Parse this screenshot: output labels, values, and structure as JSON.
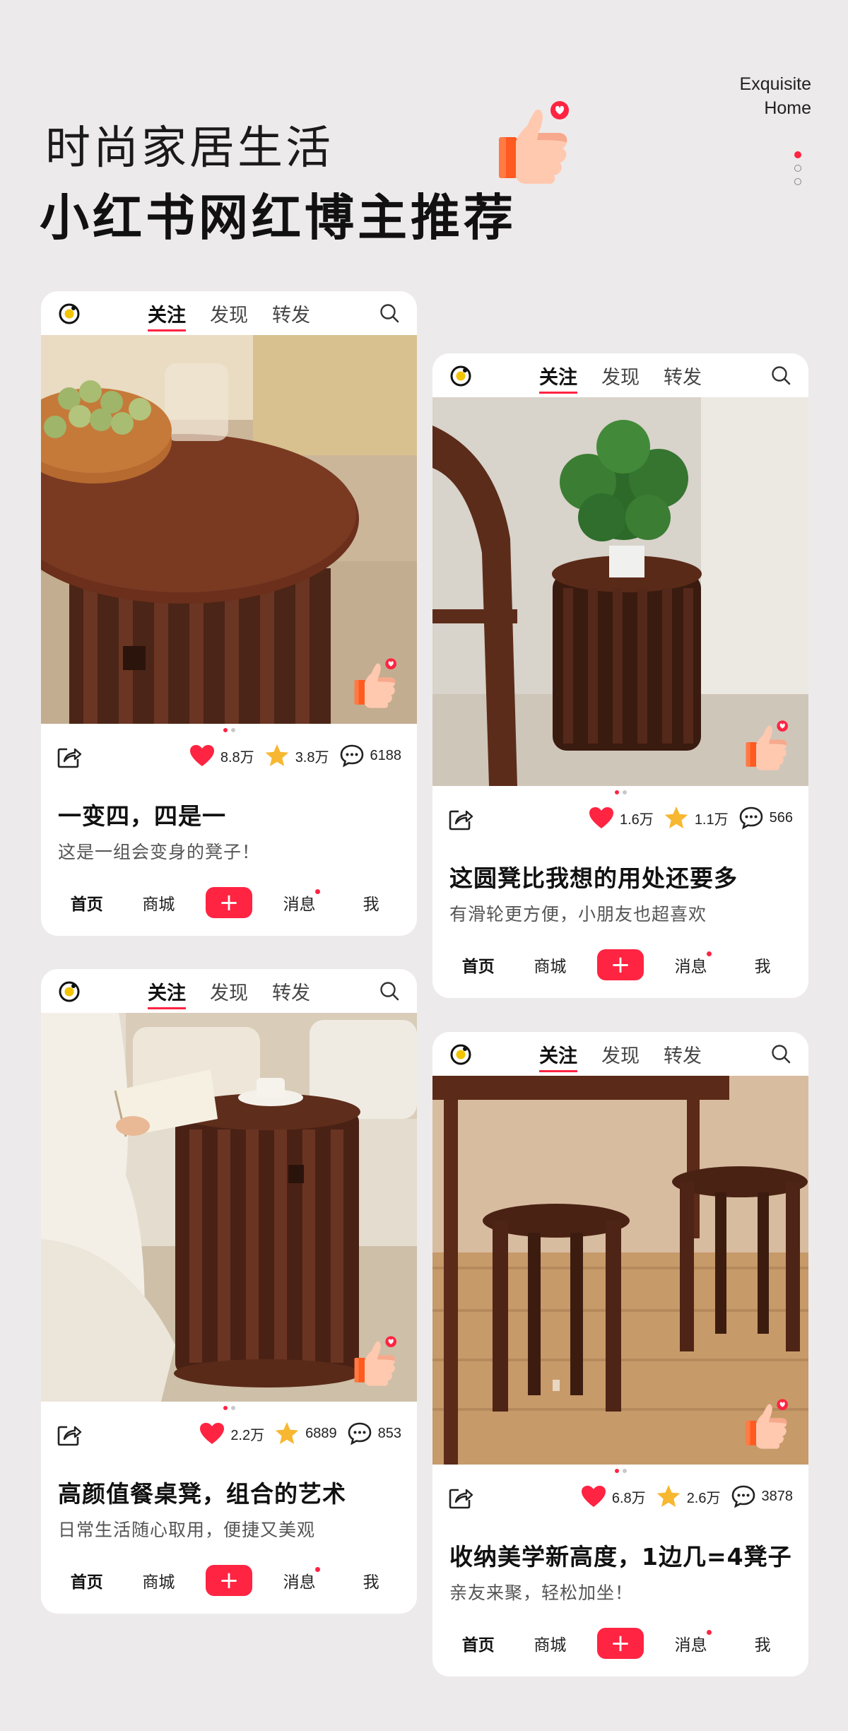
{
  "header": {
    "title_line1": "时尚家居生活",
    "title_line2": "小红书网红博主推荐",
    "brand_line1": "Exquisite",
    "brand_line2": "Home"
  },
  "colors": {
    "accent": "#ff2442",
    "background": "#edeaeb",
    "star": "#f7b731",
    "wood": "#5a2d1c"
  },
  "nav": {
    "tabs": [
      "关注",
      "发现",
      "转发"
    ],
    "bottom": [
      "首页",
      "商城",
      "+",
      "消息",
      "我"
    ]
  },
  "cards": [
    {
      "likes": "8.8万",
      "stars": "3.8万",
      "comments": "6188",
      "title": "一变四，四是一",
      "subtitle": "这是一组会变身的凳子！"
    },
    {
      "likes": "1.6万",
      "stars": "1.1万",
      "comments": "566",
      "title": "这圆凳比我想的用处还要多",
      "subtitle": "有滑轮更方便，小朋友也超喜欢"
    },
    {
      "likes": "2.2万",
      "stars": "6889",
      "comments": "853",
      "title": "高颜值餐桌凳，组合的艺术",
      "subtitle": "日常生活随心取用，便捷又美观"
    },
    {
      "likes": "6.8万",
      "stars": "2.6万",
      "comments": "3878",
      "title": "收纳美学新高度，1边几=4凳子",
      "subtitle": "亲友来聚，轻松加坐！"
    }
  ],
  "icons": [
    "thumbs-up-icon",
    "heart-icon",
    "star-icon",
    "comment-icon",
    "share-icon",
    "search-icon",
    "logo-icon"
  ]
}
